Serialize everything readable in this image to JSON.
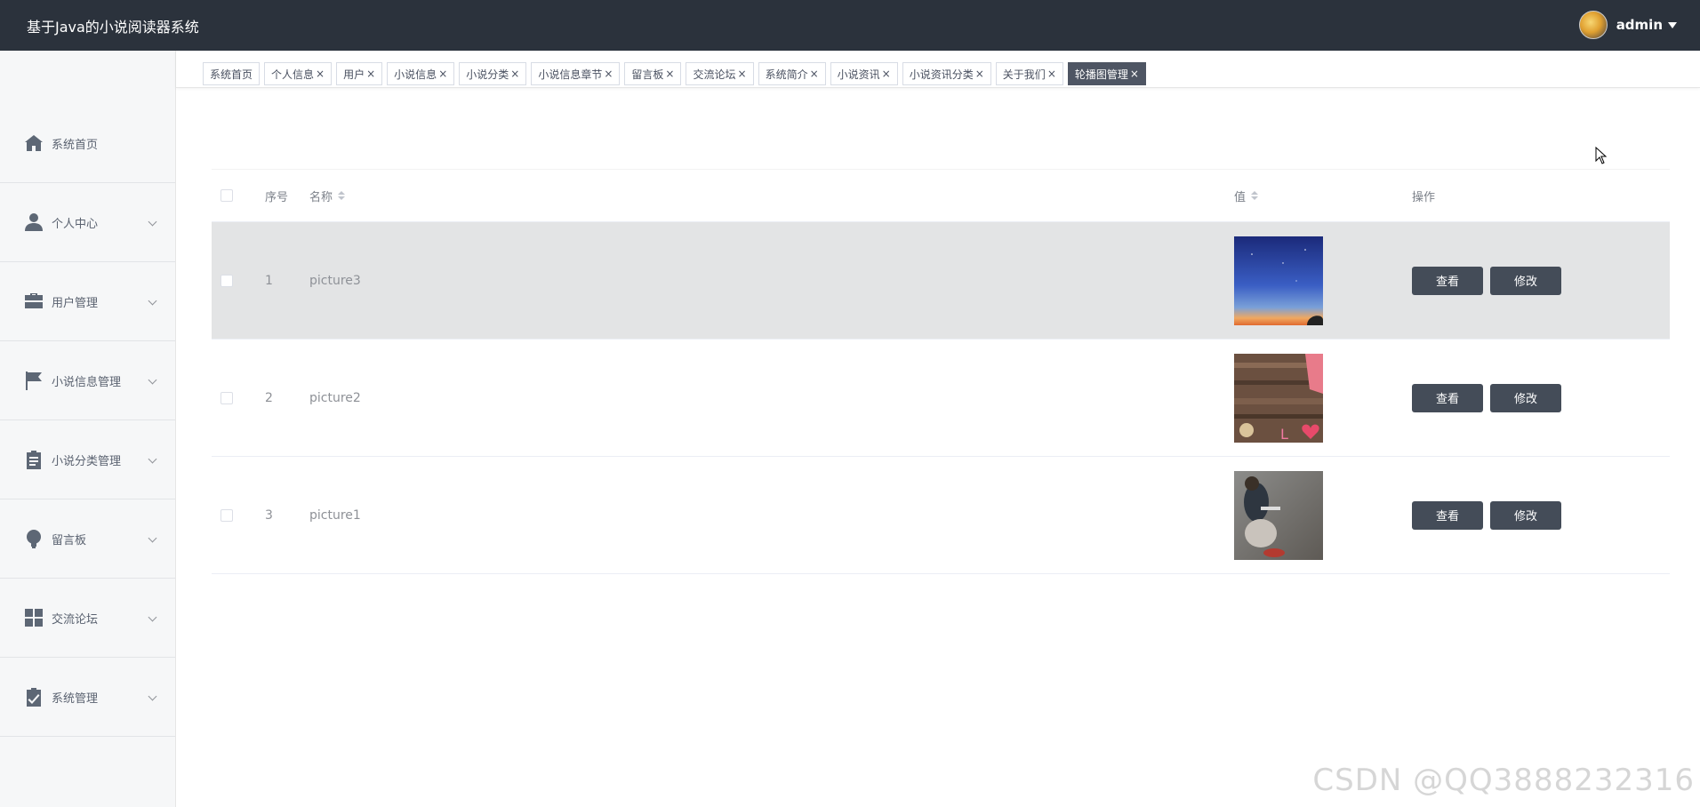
{
  "header": {
    "app_title": "基于Java的小说阅读器系统",
    "username": "admin"
  },
  "sidebar": {
    "items": [
      {
        "label": "系统首页",
        "icon": "home-icon"
      },
      {
        "label": "个人中心",
        "icon": "user-icon"
      },
      {
        "label": "用户管理",
        "icon": "briefcase-icon"
      },
      {
        "label": "小说信息管理",
        "icon": "flag-icon"
      },
      {
        "label": "小说分类管理",
        "icon": "clipboard-icon"
      },
      {
        "label": "留言板",
        "icon": "lightbulb-icon"
      },
      {
        "label": "交流论坛",
        "icon": "grid-icon"
      },
      {
        "label": "系统管理",
        "icon": "checklist-icon"
      }
    ]
  },
  "tags": [
    {
      "label": "系统首页",
      "close": ""
    },
    {
      "label": "个人信息",
      "close": "×"
    },
    {
      "label": "用户",
      "close": "×"
    },
    {
      "label": "小说信息",
      "close": "×"
    },
    {
      "label": "小说分类",
      "close": "×"
    },
    {
      "label": "小说信息章节",
      "close": "×"
    },
    {
      "label": "留言板",
      "close": "×"
    },
    {
      "label": "交流论坛",
      "close": "×"
    },
    {
      "label": "系统简介",
      "close": "×"
    },
    {
      "label": "小说资讯",
      "close": "×"
    },
    {
      "label": "小说资讯分类",
      "close": "×"
    },
    {
      "label": "关于我们",
      "close": "×"
    },
    {
      "label": "轮播图管理",
      "close": "×"
    }
  ],
  "table": {
    "columns": {
      "index": "序号",
      "name": "名称",
      "value": "值",
      "actions": "操作"
    },
    "rows": [
      {
        "index": "1",
        "name": "picture3",
        "value_image": "night-sky-sunset-image"
      },
      {
        "index": "2",
        "name": "picture2",
        "value_image": "wooden-heart-love-image"
      },
      {
        "index": "3",
        "name": "picture1",
        "value_image": "couple-outdoors-image"
      }
    ],
    "view_label": "查看",
    "edit_label": "修改"
  },
  "watermark": "CSDN @QQ3888232316",
  "colors": {
    "header_bg": "#2b323c",
    "sidebar_bg": "#f6f7f8",
    "button_bg": "#444c58",
    "active_tag_bg": "#4e5563",
    "row_hover_bg": "#e3e4e5"
  }
}
